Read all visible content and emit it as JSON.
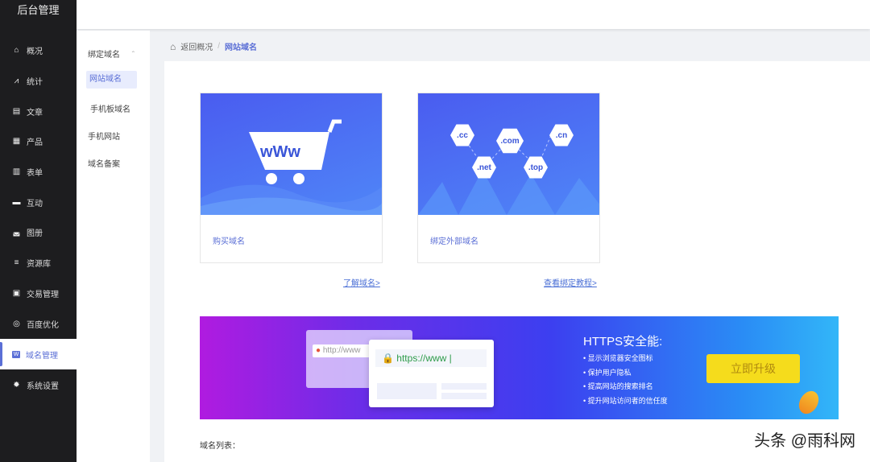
{
  "app_title": "后台管理",
  "nav": [
    {
      "label": "概况",
      "icon": "home-icon",
      "glyph": "⌂"
    },
    {
      "label": "统计",
      "icon": "chart-icon",
      "glyph": "⩘"
    },
    {
      "label": "文章",
      "icon": "article-icon",
      "glyph": "▤"
    },
    {
      "label": "产品",
      "icon": "grid-icon",
      "glyph": "▦"
    },
    {
      "label": "表单",
      "icon": "form-icon",
      "glyph": "▥"
    },
    {
      "label": "互动",
      "icon": "chat-icon",
      "glyph": "▬"
    },
    {
      "label": "图册",
      "icon": "album-icon",
      "glyph": "◛"
    },
    {
      "label": "资源库",
      "icon": "database-icon",
      "glyph": "≡"
    },
    {
      "label": "交易管理",
      "icon": "clipboard-icon",
      "glyph": "▣"
    },
    {
      "label": "百度优化",
      "icon": "target-icon",
      "glyph": "◎"
    },
    {
      "label": "域名管理",
      "icon": "domain-icon",
      "glyph": "W"
    },
    {
      "label": "系统设置",
      "icon": "gear-icon",
      "glyph": "✹"
    }
  ],
  "submenu": {
    "group": "绑定域名",
    "items": [
      "网站域名",
      "手机板域名"
    ],
    "others": [
      "手机网站",
      "域名备案"
    ]
  },
  "breadcrumb": {
    "back": "返回概况",
    "sep": "/",
    "current": "网站域名"
  },
  "cards": [
    {
      "label": "购买域名",
      "link": "了解域名>",
      "art_text": "wWw"
    },
    {
      "label": "绑定外部域名",
      "link": "查看绑定教程>",
      "tlds": [
        ".cc",
        ".com",
        ".cn",
        ".net",
        ".top"
      ]
    }
  ],
  "banner": {
    "title": "HTTPS安全能:",
    "bullets": [
      "显示浏览器安全图标",
      "保护用户隐私",
      "提高网站的搜索排名",
      "提升网站访问者的信任度"
    ],
    "button": "立即升级",
    "old_url": "http://www",
    "new_url": "https://www |"
  },
  "list_title": "域名列表：",
  "watermark": "头条 @雨科网"
}
